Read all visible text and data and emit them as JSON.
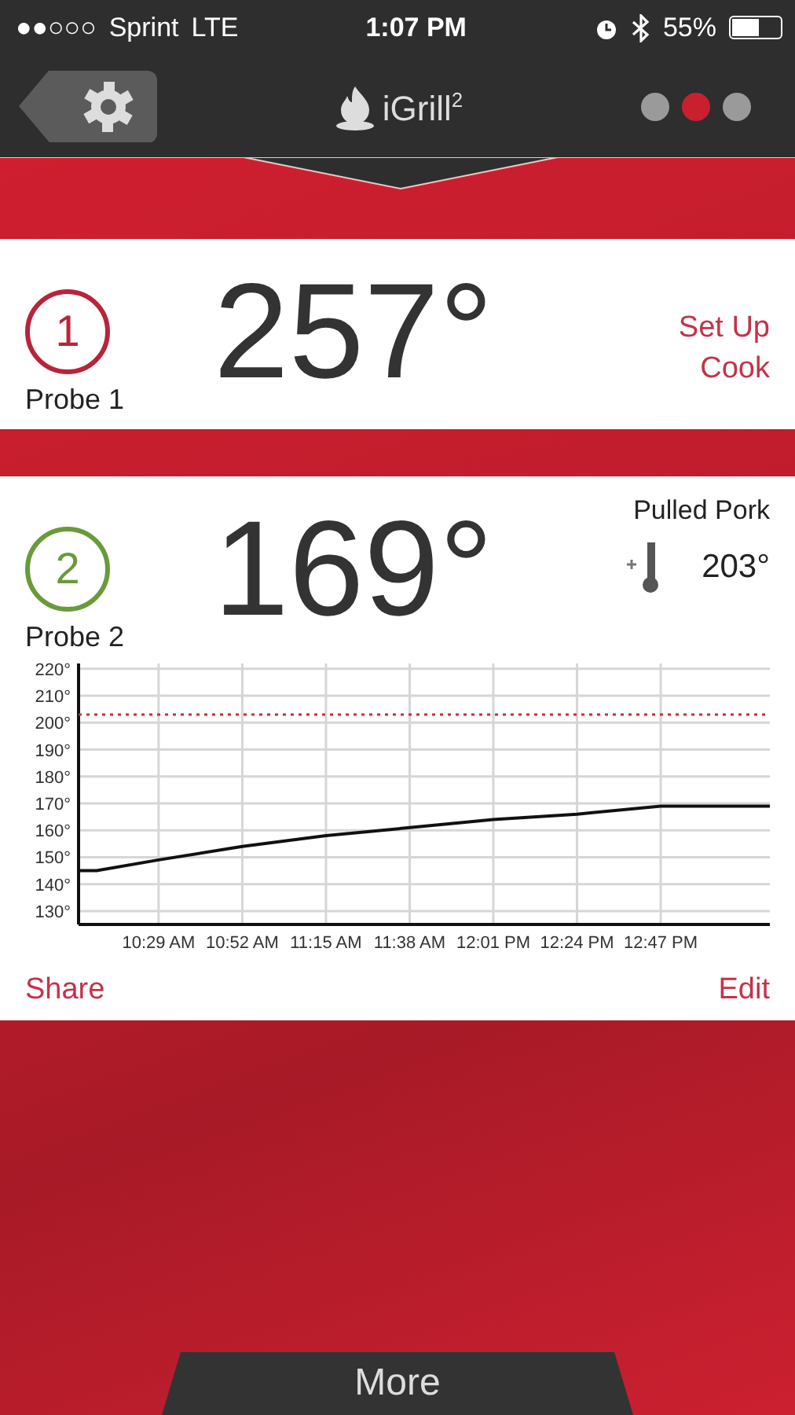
{
  "status_bar": {
    "signal": "●●○○○",
    "carrier": "Sprint",
    "network": "LTE",
    "time": "1:07 PM",
    "battery": "55%"
  },
  "header": {
    "app_name": "iGrill",
    "app_sup": "2",
    "pages": [
      {
        "selected": false
      },
      {
        "selected": true
      },
      {
        "selected": false
      }
    ]
  },
  "probes": [
    {
      "number": "1",
      "name": "Probe 1",
      "temperature": "257°",
      "color": "#b8243a",
      "actions": [
        "Set Up",
        "Cook"
      ]
    },
    {
      "number": "2",
      "name": "Probe 2",
      "temperature": "169°",
      "color": "#6a9a3a",
      "preset": {
        "name": "Pulled Pork",
        "target": "203°"
      },
      "chart_data": {
        "type": "line",
        "x": [
          607,
          612,
          629,
          652,
          675,
          698,
          721,
          744,
          767,
          797
        ],
        "series": [
          {
            "color": "#111111",
            "line_style": "solid",
            "values": [
              145,
              145,
              149,
              154,
              158,
              161,
              164,
              166,
              169,
              169
            ]
          },
          {
            "color": "#c0303a",
            "line_style": "dotted",
            "values": [
              203,
              203,
              203,
              203,
              203,
              203,
              203,
              203,
              203,
              203
            ]
          }
        ],
        "grid": true,
        "xlim": [
          607,
          797
        ],
        "ylim": [
          125,
          222
        ],
        "xticks": [
          {
            "value": 629,
            "label": "10:29 AM"
          },
          {
            "value": 652,
            "label": "10:52 AM"
          },
          {
            "value": 675,
            "label": "11:15 AM"
          },
          {
            "value": 698,
            "label": "11:38 AM"
          },
          {
            "value": 721,
            "label": "12:01 PM"
          },
          {
            "value": 744,
            "label": "12:24 PM"
          },
          {
            "value": 767,
            "label": "12:47 PM"
          }
        ],
        "yticks": [
          {
            "value": 130,
            "label": "130°"
          },
          {
            "value": 140,
            "label": "140°"
          },
          {
            "value": 150,
            "label": "150°"
          },
          {
            "value": 160,
            "label": "160°"
          },
          {
            "value": 170,
            "label": "170°"
          },
          {
            "value": 180,
            "label": "180°"
          },
          {
            "value": 190,
            "label": "190°"
          },
          {
            "value": 200,
            "label": "200°"
          },
          {
            "value": 210,
            "label": "210°"
          },
          {
            "value": 220,
            "label": "220°"
          }
        ]
      },
      "actions": [
        "Share",
        "Edit"
      ]
    }
  ],
  "footer": {
    "more": "More"
  }
}
